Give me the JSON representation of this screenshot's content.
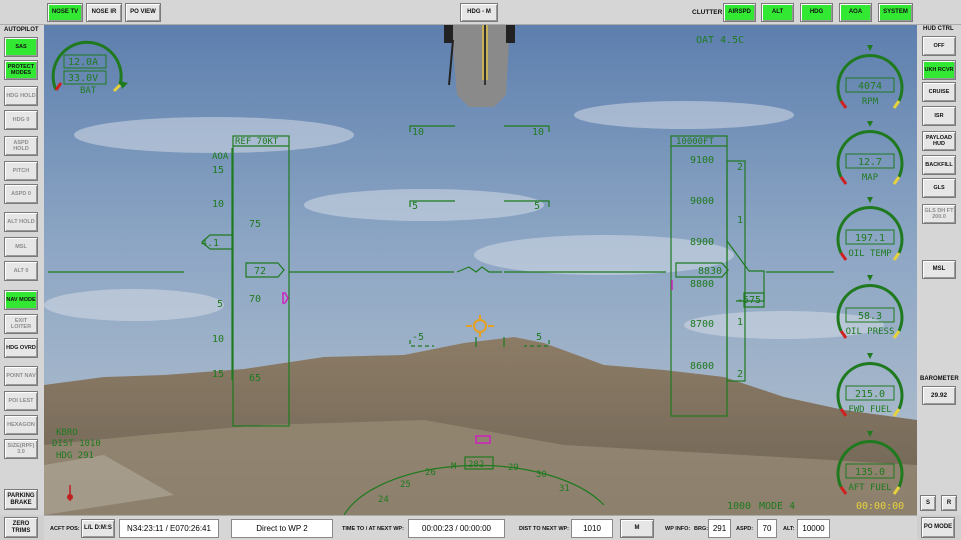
{
  "top": {
    "nose_tv": "NOSE TV",
    "nose_ir": "NOSE IR",
    "po_view": "PO VIEW",
    "hdg_mode": "HDG - M",
    "clutter_label": "CLUTTER:",
    "clutter": [
      "AIRSPD",
      "ALT",
      "HDG",
      "AOA",
      "SYSTEM"
    ]
  },
  "autopilot": {
    "title": "AUTOPILOT",
    "items": [
      {
        "label": "SAS",
        "state": "on"
      },
      {
        "label": "PROTECT MODES",
        "state": "on"
      },
      {
        "label": "HDG HOLD",
        "state": "dim"
      },
      {
        "label": "HDG 0",
        "state": "dim"
      },
      {
        "label": "ASPD HOLD",
        "state": "dim"
      },
      {
        "label": "PITCH",
        "state": "dim"
      },
      {
        "label": "ASPD 0",
        "state": "dim"
      },
      {
        "label": "ALT HOLD",
        "state": "dim"
      },
      {
        "label": "MSL",
        "state": "dim"
      },
      {
        "label": "ALT 0",
        "state": "dim"
      },
      {
        "label": "NAV MODE",
        "state": "on"
      },
      {
        "label": "EXIT LOITER",
        "state": "dim"
      },
      {
        "label": "HDG OVRD",
        "state": "normal"
      },
      {
        "label": "POINT NAV",
        "state": "dim"
      },
      {
        "label": "POI LEST",
        "state": "dim"
      },
      {
        "label": "HEXAGON",
        "state": "dim"
      },
      {
        "label": "SIZE(RPF) 3.0",
        "state": "dim"
      }
    ],
    "parking_brake": "PARKING BRAKE",
    "zero_trims": "ZERO TRIMS"
  },
  "hud_ctrl": {
    "title": "HUD CTRL",
    "items": [
      {
        "label": "OFF",
        "state": "normal"
      },
      {
        "label": "UKH RCVR",
        "state": "on"
      },
      {
        "label": "CRUISE",
        "state": "normal"
      },
      {
        "label": "ISR",
        "state": "normal"
      },
      {
        "label": "PAYLOAD HUD",
        "state": "normal"
      },
      {
        "label": "BACKFILL",
        "state": "normal"
      },
      {
        "label": "GLS",
        "state": "normal"
      },
      {
        "label": "GLS DH FT 200.0",
        "state": "dim"
      }
    ],
    "msl": "MSL",
    "barometer_title": "BAROMETER",
    "barometer": "29.92",
    "s": "S",
    "r": "R",
    "po_mode": "PO MODE"
  },
  "bottom": {
    "acft_pos_label": "ACFT POS:",
    "format": "L/L D:M:S",
    "position": "N34:23:11 / E070:26:41",
    "direct_to": "Direct to WP 2",
    "time_label": "TIME TO / AT NEXT WP:",
    "time": "00:00:23 / 00:00:00",
    "dist_label": "DIST TO NEXT WP:",
    "dist": "1010",
    "unit": "M",
    "wp_info_label": "WP INFO:",
    "brg_label": "BRG:",
    "brg": "291",
    "aspd_label": "ASPD:",
    "aspd": "70",
    "alt_label": "ALT:",
    "alt": "10000"
  },
  "hud": {
    "oat": "OAT  4.5C",
    "bat_amps": "12.0A",
    "bat_volts": "33.0V",
    "bat_label": "BAT",
    "gauges": [
      {
        "label": "RPM",
        "value": "4074"
      },
      {
        "label": "MAP",
        "value": "12.7"
      },
      {
        "label": "OIL TEMP",
        "value": "197.1"
      },
      {
        "label": "OIL PRESS",
        "value": "58.3"
      },
      {
        "label": "FWD FUEL",
        "value": "215.0"
      },
      {
        "label": "AFT FUEL",
        "value": "135.0"
      }
    ],
    "airspeed_ref": "REF  70KT",
    "aoa_label": "AOA",
    "aoa_value": "4.1",
    "airspeed": "72",
    "speed_ticks": [
      "75",
      "70",
      "65"
    ],
    "aoa_ticks": [
      "15",
      "10",
      "5",
      "5",
      "10",
      "15"
    ],
    "alt_ref": "10000FT",
    "alt_ticks": [
      "9100",
      "9000",
      "8900",
      "8800",
      "8700",
      "8600"
    ],
    "altitude": "8830",
    "vsi_ticks": [
      "2",
      "1",
      "1",
      "2"
    ],
    "vsi_value": "-575",
    "pitch_labels": [
      "10",
      "10",
      "5",
      "5",
      "-5",
      "5"
    ],
    "heading_value": "282",
    "heading_ticks": [
      "24",
      "25",
      "26",
      "M",
      "29",
      "30",
      "31"
    ],
    "bottom_left": [
      "KBRO",
      "DIST 1010",
      "HDG 291"
    ],
    "mode": "MODE 4",
    "mode_prefix": "1000",
    "timer": "00:00:00"
  }
}
